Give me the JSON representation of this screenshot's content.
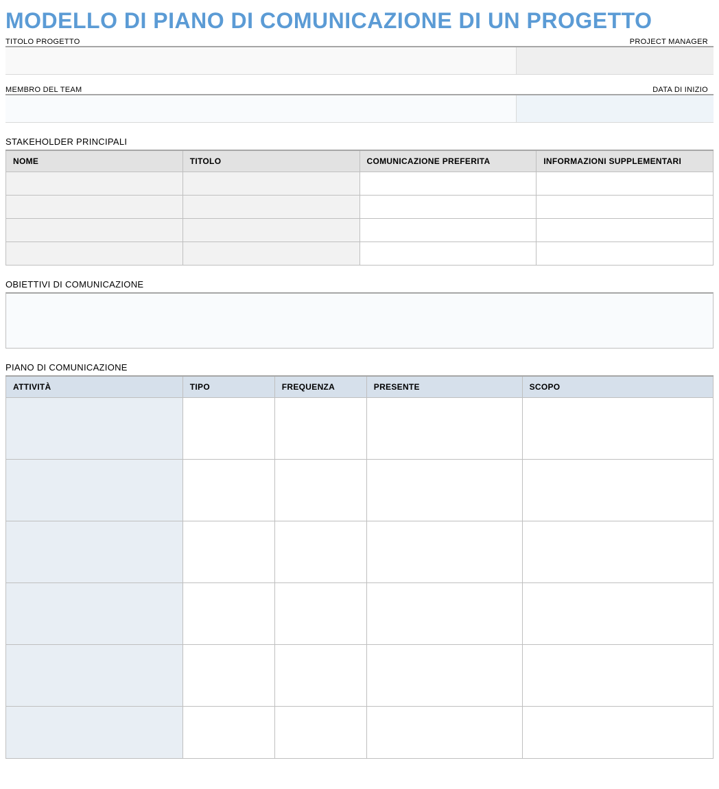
{
  "title": "MODELLO DI PIANO DI COMUNICAZIONE DI UN PROGETTO",
  "fields": {
    "project_title_label": "TITOLO PROGETTO",
    "project_manager_label": "PROJECT MANAGER",
    "team_member_label": "MEMBRO DEL TEAM",
    "start_date_label": "DATA DI INIZIO",
    "project_title_value": "",
    "project_manager_value": "",
    "team_member_value": "",
    "start_date_value": ""
  },
  "stakeholders": {
    "section_label": "STAKEHOLDER PRINCIPALI",
    "headers": [
      "NOME",
      "TITOLO",
      "COMUNICAZIONE PREFERITA",
      "INFORMAZIONI SUPPLEMENTARI"
    ],
    "rows": [
      {
        "nome": "",
        "titolo": "",
        "com": "",
        "info": ""
      },
      {
        "nome": "",
        "titolo": "",
        "com": "",
        "info": ""
      },
      {
        "nome": "",
        "titolo": "",
        "com": "",
        "info": ""
      },
      {
        "nome": "",
        "titolo": "",
        "com": "",
        "info": ""
      }
    ]
  },
  "goals": {
    "section_label": "OBIETTIVI DI COMUNICAZIONE",
    "value": ""
  },
  "plan": {
    "section_label": "PIANO DI COMUNICAZIONE",
    "headers": [
      "ATTIVITÀ",
      "TIPO",
      "FREQUENZA",
      "PRESENTE",
      "SCOPO"
    ],
    "rows": [
      {
        "att": "",
        "tipo": "",
        "freq": "",
        "pres": "",
        "scopo": ""
      },
      {
        "att": "",
        "tipo": "",
        "freq": "",
        "pres": "",
        "scopo": ""
      },
      {
        "att": "",
        "tipo": "",
        "freq": "",
        "pres": "",
        "scopo": ""
      },
      {
        "att": "",
        "tipo": "",
        "freq": "",
        "pres": "",
        "scopo": ""
      },
      {
        "att": "",
        "tipo": "",
        "freq": "",
        "pres": "",
        "scopo": ""
      },
      {
        "att": "",
        "tipo": "",
        "freq": "",
        "pres": "",
        "scopo": ""
      }
    ]
  }
}
